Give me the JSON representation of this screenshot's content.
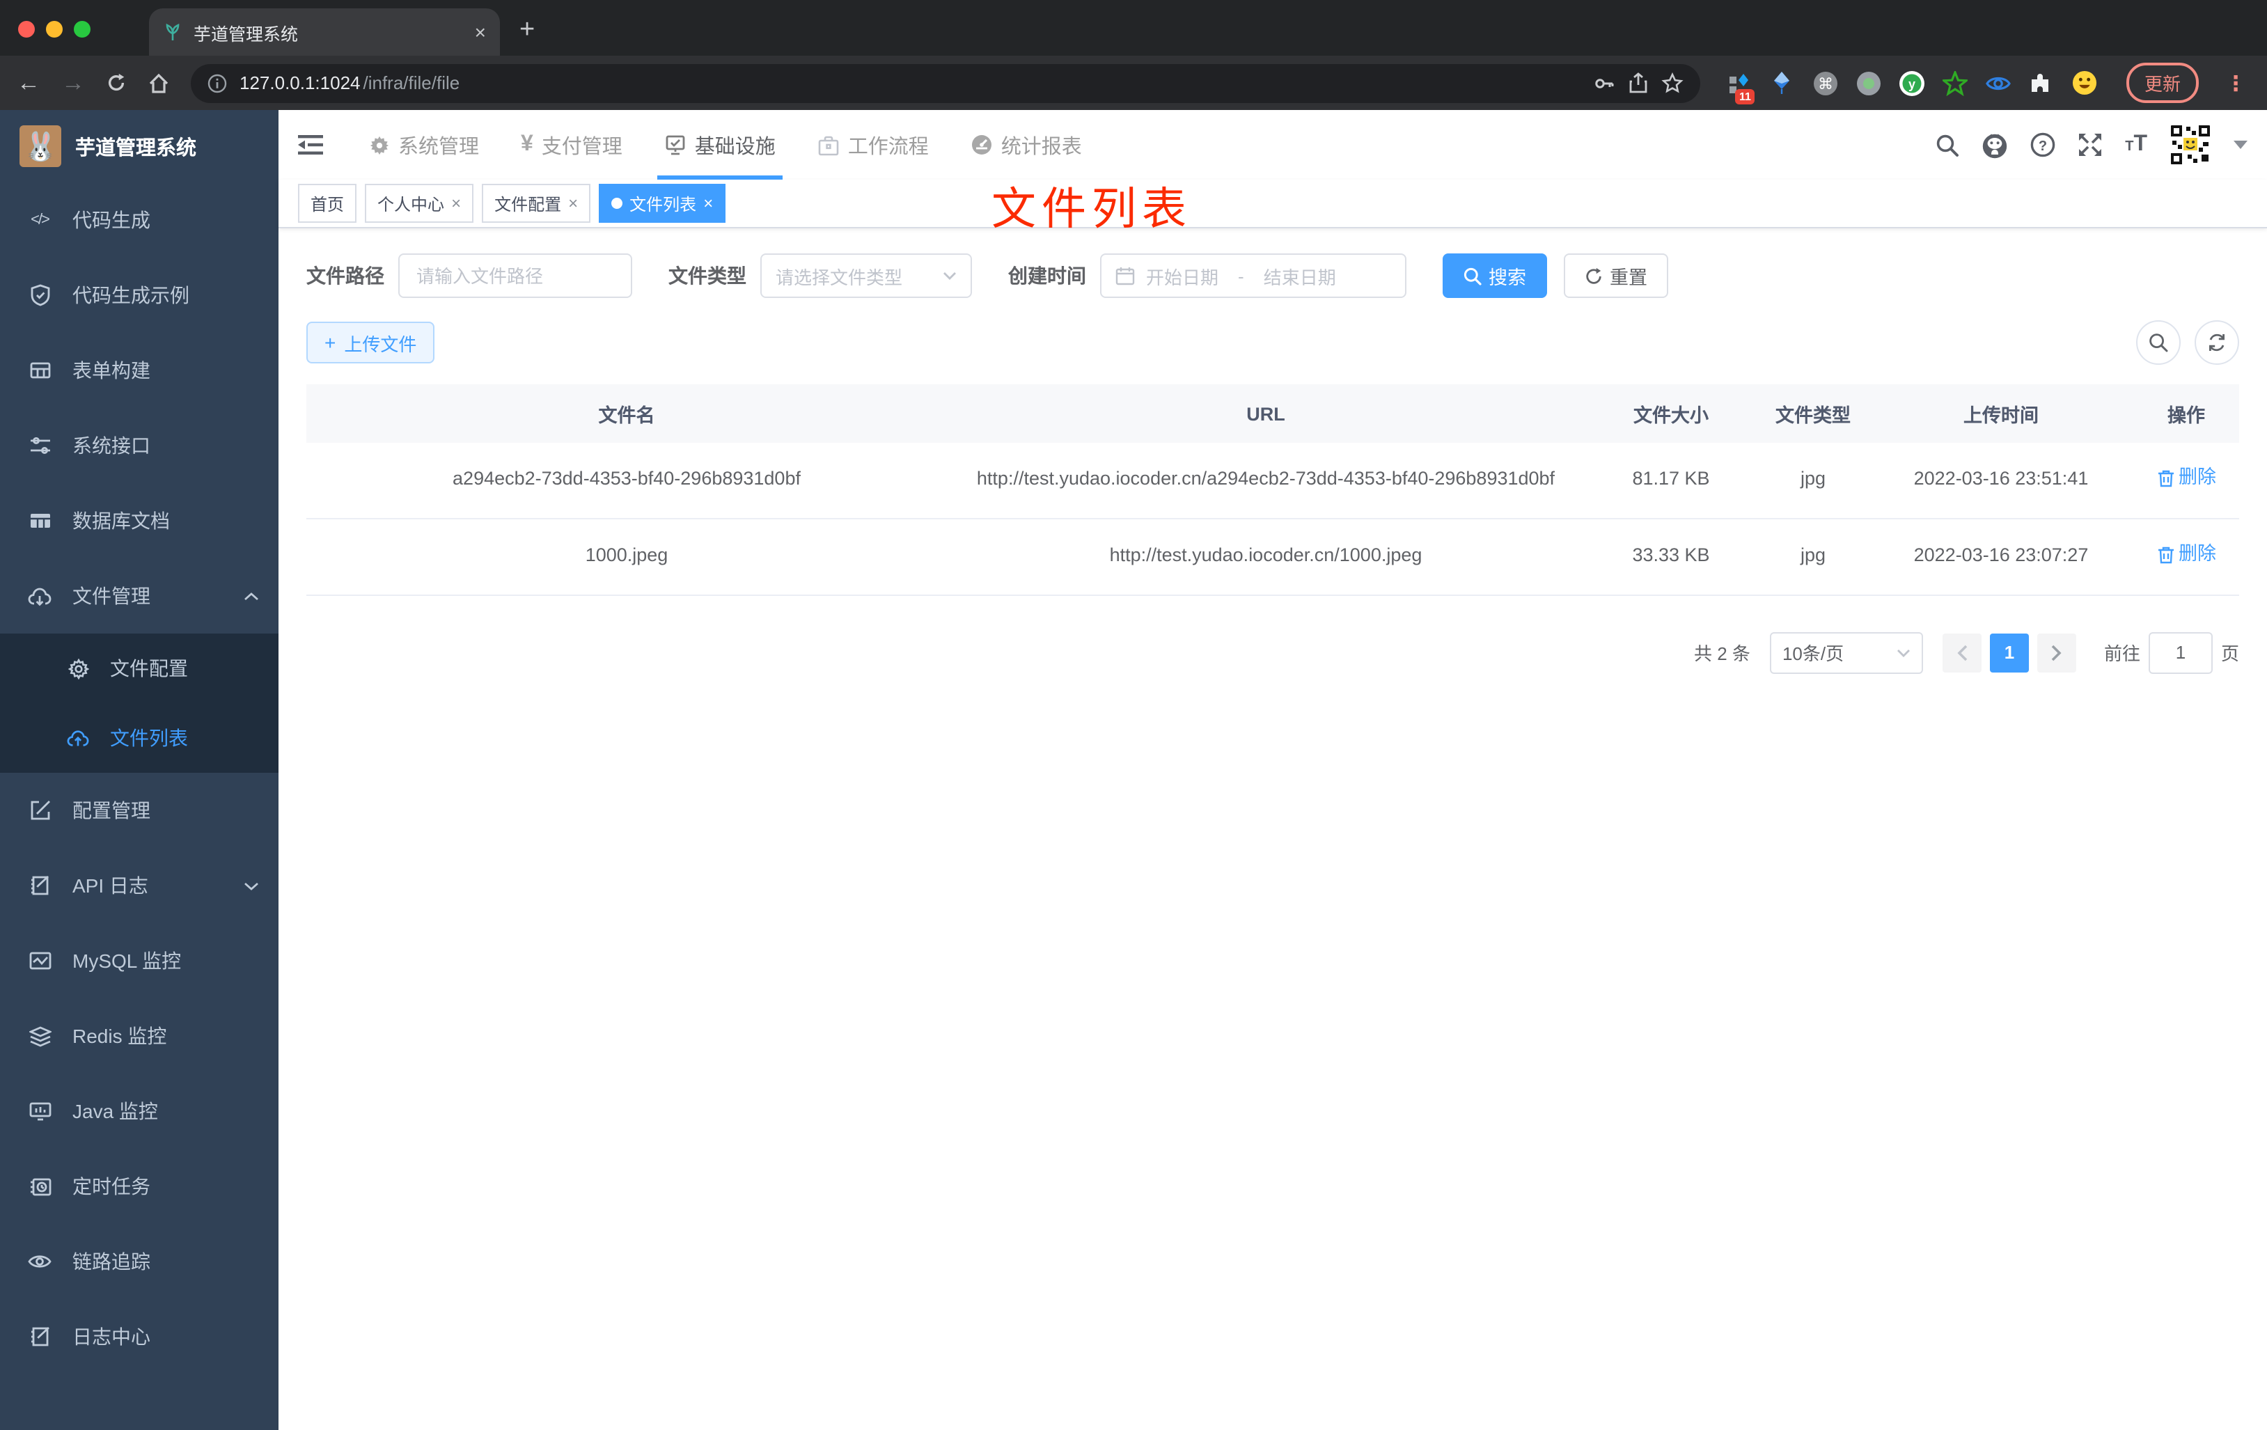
{
  "colors": {
    "accent": "#409eff",
    "annotation_red": "#fb2b01",
    "sidebar_bg": "#304156",
    "submenu_bg": "#1f2d3d",
    "badge_red": "#e94235"
  },
  "icons": {
    "close": "×",
    "plus": "+",
    "yen": "¥",
    "code": "</>",
    "dots": "⋮",
    "font_small": "T",
    "font_big": "T"
  },
  "browser": {
    "tab_title": "芋道管理系统",
    "url_host": "127.0.0.1:1024",
    "url_path": "/infra/file/file",
    "update_label": "更新",
    "ext_badge": "11"
  },
  "sidebar": {
    "app_title": "芋道管理系统",
    "items": [
      {
        "label": "代码生成"
      },
      {
        "label": "代码生成示例"
      },
      {
        "label": "表单构建"
      },
      {
        "label": "系统接口"
      },
      {
        "label": "数据库文档"
      },
      {
        "label": "文件管理"
      },
      {
        "label": "配置管理"
      },
      {
        "label": "API 日志"
      },
      {
        "label": "MySQL 监控"
      },
      {
        "label": "Redis 监控"
      },
      {
        "label": "Java 监控"
      },
      {
        "label": "定时任务"
      },
      {
        "label": "链路追踪"
      },
      {
        "label": "日志中心"
      }
    ],
    "submenu": [
      {
        "label": "文件配置"
      },
      {
        "label": "文件列表"
      }
    ]
  },
  "navbar": {
    "items": [
      {
        "label": "系统管理"
      },
      {
        "label": "支付管理"
      },
      {
        "label": "基础设施"
      },
      {
        "label": "工作流程"
      },
      {
        "label": "统计报表"
      }
    ]
  },
  "tags": [
    {
      "label": "首页"
    },
    {
      "label": "个人中心"
    },
    {
      "label": "文件配置"
    },
    {
      "label": "文件列表"
    }
  ],
  "annotation": "文件列表",
  "filters": {
    "path_label": "文件路径",
    "path_placeholder": "请输入文件路径",
    "type_label": "文件类型",
    "type_placeholder": "请选择文件类型",
    "date_label": "创建时间",
    "date_start": "开始日期",
    "date_sep": "-",
    "date_end": "结束日期",
    "search": "搜索",
    "reset": "重置"
  },
  "toolbar": {
    "upload": "上传文件"
  },
  "table": {
    "headers": [
      "文件名",
      "URL",
      "文件大小",
      "文件类型",
      "上传时间",
      "操作"
    ],
    "rows": [
      {
        "name": "a294ecb2-73dd-4353-bf40-296b8931d0bf",
        "url": "http://test.yudao.iocoder.cn/a294ecb2-73dd-4353-bf40-296b8931d0bf",
        "size": "81.17 KB",
        "type": "jpg",
        "time": "2022-03-16 23:51:41",
        "action": "删除"
      },
      {
        "name": "1000.jpeg",
        "url": "http://test.yudao.iocoder.cn/1000.jpeg",
        "size": "33.33 KB",
        "type": "jpg",
        "time": "2022-03-16 23:07:27",
        "action": "删除"
      }
    ]
  },
  "pagination": {
    "total": "共 2 条",
    "page_size": "10条/页",
    "page": "1",
    "goto": "前往",
    "goto_value": "1",
    "page_suffix": "页"
  }
}
